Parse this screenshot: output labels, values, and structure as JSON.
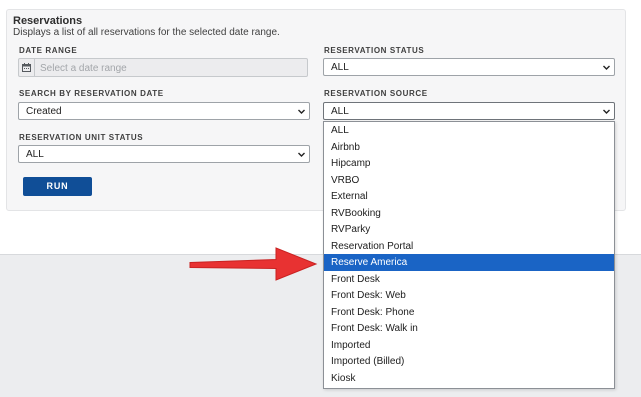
{
  "panel": {
    "title": "Reservations",
    "description": "Displays a list of all reservations for the selected date range."
  },
  "date_range": {
    "label": "DATE RANGE",
    "placeholder": "Select a date range",
    "icon": "calendar-icon"
  },
  "reservation_status": {
    "label": "RESERVATION STATUS",
    "value": "ALL"
  },
  "search_by_date": {
    "label": "SEARCH BY RESERVATION DATE",
    "value": "Created"
  },
  "reservation_source": {
    "label": "RESERVATION SOURCE",
    "value": "ALL",
    "selected_option": "Reserve America",
    "options": [
      "ALL",
      "Airbnb",
      "Hipcamp",
      "VRBO",
      "External",
      "RVBooking",
      "RVParky",
      "Reservation Portal",
      "Reserve America",
      "Front Desk",
      "Front Desk: Web",
      "Front Desk: Phone",
      "Front Desk: Walk in",
      "Imported",
      "Imported (Billed)",
      "Kiosk"
    ]
  },
  "unit_status": {
    "label": "RESERVATION UNIT STATUS",
    "value": "ALL"
  },
  "run_button": {
    "label": "RUN"
  },
  "colors": {
    "primary_button": "#104e97",
    "option_highlight": "#1a64c5",
    "annotation_arrow": "#e83232"
  }
}
